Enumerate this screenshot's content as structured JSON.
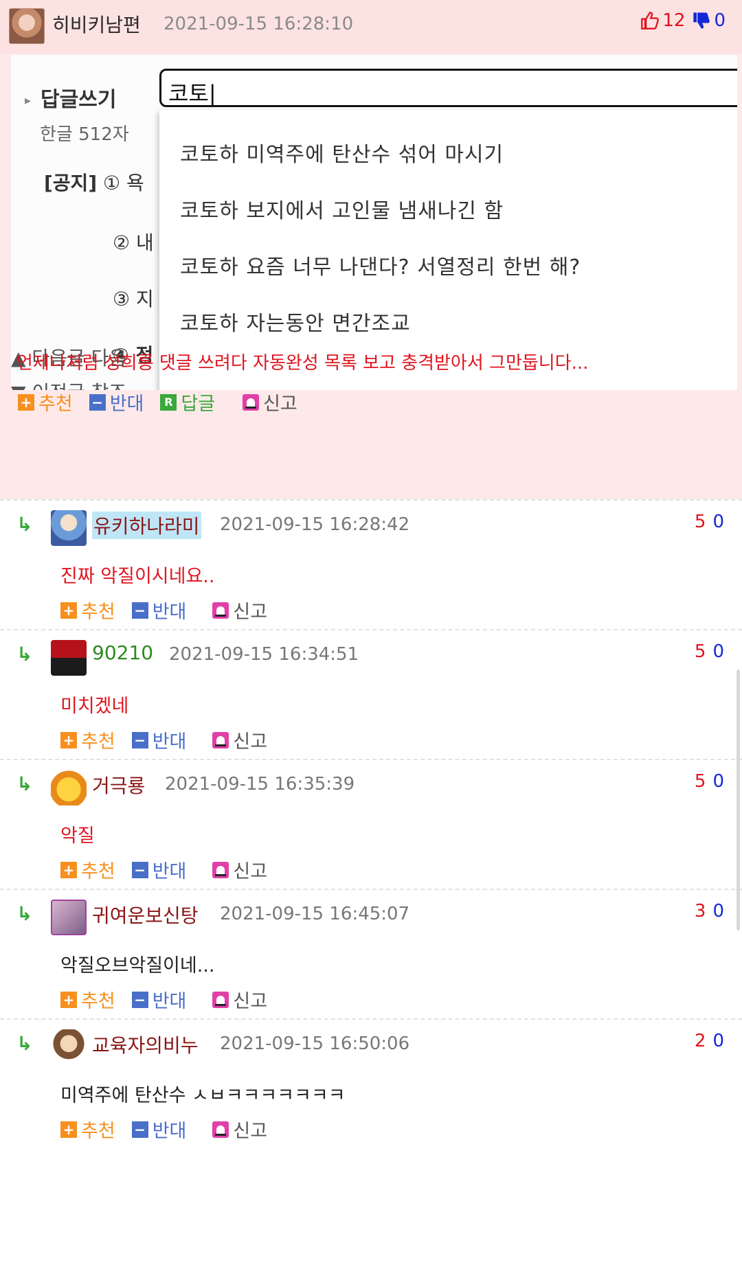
{
  "post": {
    "author": "히비키남편",
    "date": "2021-09-15 16:28:10",
    "upvotes": "12",
    "downvotes": "0",
    "body": "언제나처럼 성희롱 댓글 쓰려다 자동완성 목록 보고 충격받아서 그만둡니다...",
    "screenshot": {
      "reply_label": "답글쓰기",
      "char_limit": "한글 512자",
      "notice_label": "[공지]",
      "notice_lines": [
        "① 욕",
        "② 내",
        "③ 지",
        "④ 정"
      ],
      "nav_next": "▲ 다음글   다음",
      "nav_prev": "▼ 이전글   참조",
      "input_value": "코토|",
      "suggestions": [
        "코토하 미역주에 탄산수 섞어 마시기",
        "코토하 보지에서 고인물 냄새나긴 함",
        "코토하 요즘 너무 나댄다? 서열정리 한번 해?",
        "코토하 자는동안 면간조교"
      ]
    },
    "actions": {
      "recommend": "추천",
      "oppose": "반대",
      "reply": "답글",
      "report": "신고",
      "reply_badge": "R"
    }
  },
  "comment_actions": {
    "recommend": "추천",
    "oppose": "반대",
    "report": "신고"
  },
  "comments": [
    {
      "author": "유키하나라미",
      "date": "2021-09-15 16:28:42",
      "up": "5",
      "down": "0",
      "text": "진짜 악질이시네요..",
      "text_color": "#e0141e"
    },
    {
      "author": "90210",
      "date": "2021-09-15 16:34:51",
      "up": "5",
      "down": "0",
      "text": "미치겠네",
      "text_color": "#e0141e"
    },
    {
      "author": "거극룡",
      "date": "2021-09-15 16:35:39",
      "up": "5",
      "down": "0",
      "text": "악질",
      "text_color": "#e0141e"
    },
    {
      "author": "귀여운보신탕",
      "date": "2021-09-15 16:45:07",
      "up": "3",
      "down": "0",
      "text": "악질오브악질이네...",
      "text_color": "#222222"
    },
    {
      "author": "교육자의비누",
      "date": "2021-09-15 16:50:06",
      "up": "2",
      "down": "0",
      "text": "미역주에 탄산수 ㅅㅂㅋㅋㅋㅋㅋㅋㅋ",
      "text_color": "#222222"
    }
  ]
}
